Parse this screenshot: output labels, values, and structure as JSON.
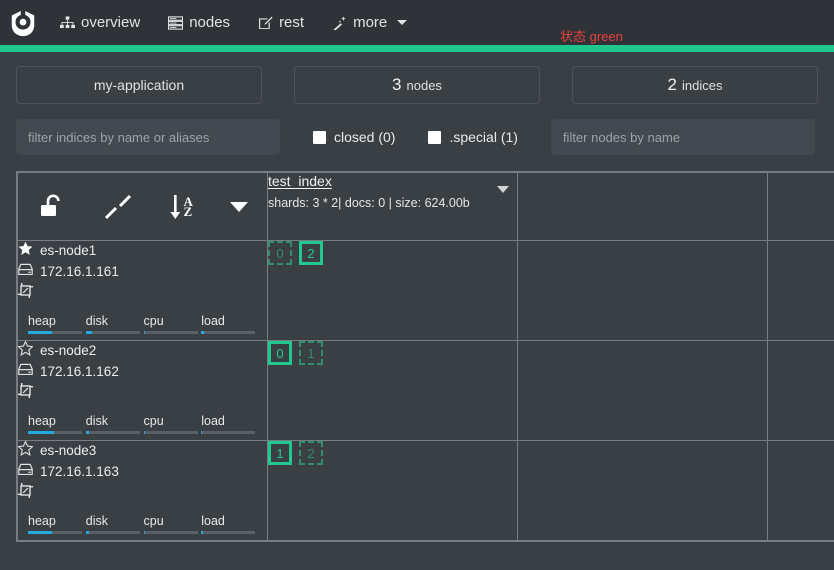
{
  "navbar": {
    "logo_name": "cerebro-logo",
    "items": [
      {
        "label": "overview",
        "icon": "sitemap-icon"
      },
      {
        "label": "nodes",
        "icon": "server-rack-icon"
      },
      {
        "label": "rest",
        "icon": "edit-square-icon"
      },
      {
        "label": "more",
        "icon": "magic-wand-icon",
        "has_caret": true
      }
    ],
    "status_text": "状态 green",
    "status_color": "#e8413a",
    "status_bar_color": "#1fc98d"
  },
  "summary": {
    "cluster_name": "my-application",
    "nodes_count": "3",
    "nodes_label": "nodes",
    "indices_count": "2",
    "indices_label": "indices"
  },
  "filters": {
    "indices_placeholder": "filter indices by name or aliases",
    "indices_value": "",
    "nodes_placeholder": "filter nodes by name",
    "nodes_value": "",
    "checkboxes": [
      {
        "label": "closed (0)",
        "checked": false
      },
      {
        "label": ".special (1)",
        "checked": false
      }
    ]
  },
  "toolbar": {
    "lock_icon": "unlock-icon",
    "expand_icon": "expand-arrows-icon",
    "sort_icon": "sort-alpha-asc-icon",
    "sort_letter_top": "A",
    "sort_letter_bottom": "Z",
    "menu_icon": "caret-down-icon"
  },
  "indices": [
    {
      "name": "test_index",
      "meta": "shards: 3 * 2| docs: 0 | size: 624.00b"
    }
  ],
  "nodes": [
    {
      "name": "es-node1",
      "master": true,
      "ip": "172.16.1.161",
      "metrics": [
        {
          "label": "heap",
          "percent": 45
        },
        {
          "label": "disk",
          "percent": 12
        },
        {
          "label": "cpu",
          "percent": 2
        },
        {
          "label": "load",
          "percent": 6
        }
      ],
      "shards": [
        {
          "num": "0",
          "type": "replica"
        },
        {
          "num": "2",
          "type": "primary"
        }
      ]
    },
    {
      "name": "es-node2",
      "master": false,
      "ip": "172.16.1.162",
      "metrics": [
        {
          "label": "heap",
          "percent": 48
        },
        {
          "label": "disk",
          "percent": 6
        },
        {
          "label": "cpu",
          "percent": 2
        },
        {
          "label": "load",
          "percent": 2
        }
      ],
      "shards": [
        {
          "num": "0",
          "type": "primary"
        },
        {
          "num": "1",
          "type": "replica"
        }
      ]
    },
    {
      "name": "es-node3",
      "master": false,
      "ip": "172.16.1.163",
      "metrics": [
        {
          "label": "heap",
          "percent": 45
        },
        {
          "label": "disk",
          "percent": 6
        },
        {
          "label": "cpu",
          "percent": 2
        },
        {
          "label": "load",
          "percent": 4
        }
      ],
      "shards": [
        {
          "num": "1",
          "type": "primary"
        },
        {
          "num": "2",
          "type": "replica"
        }
      ]
    }
  ],
  "colors": {
    "primary_shard": "#21c98e",
    "replica_shard": "#2f8f6c",
    "metric_bar": "#26a9e0",
    "background": "#3a3f44",
    "navbar": "#2f3337"
  }
}
